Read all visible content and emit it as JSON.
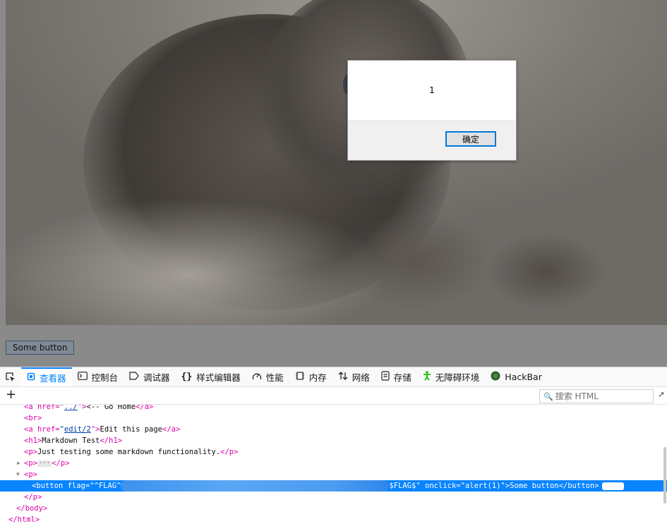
{
  "page": {
    "button_label": "Some button"
  },
  "dialog": {
    "message": "1",
    "ok_label": "确定"
  },
  "devtools": {
    "tabs": [
      {
        "label": "查看器",
        "icon": "inspector-icon",
        "active": true
      },
      {
        "label": "控制台",
        "icon": "console-icon"
      },
      {
        "label": "调试器",
        "icon": "debugger-icon"
      },
      {
        "label": "样式编辑器",
        "icon": "style-editor-icon"
      },
      {
        "label": "性能",
        "icon": "performance-icon"
      },
      {
        "label": "内存",
        "icon": "memory-icon"
      },
      {
        "label": "网络",
        "icon": "network-icon"
      },
      {
        "label": "存储",
        "icon": "storage-icon"
      },
      {
        "label": "无障碍环境",
        "icon": "accessibility-icon"
      },
      {
        "label": "HackBar",
        "icon": "hackbar-icon"
      }
    ],
    "search_placeholder": "搜索 HTML",
    "accent": "#0a84ff",
    "markup": {
      "line1": {
        "tag_open": "<a ",
        "attr": "href=",
        "q1": "\"",
        "href": "../",
        "q2": "\">",
        "text": "<-- Go Home",
        "tag_close": "</a>"
      },
      "line2": "<br>",
      "line3": {
        "tag_open": "<a ",
        "attr": "href=",
        "q1": "\"",
        "href": "edit/2",
        "q2": "\">",
        "text": "Edit this page",
        "tag_close": "</a>"
      },
      "line4": {
        "open": "<h1>",
        "text": "Markdown Test",
        "close": "</h1>"
      },
      "line5": {
        "open": "<p>",
        "text": "Just testing some markdown functionality.",
        "close": "</p>"
      },
      "line6": {
        "open": "<p>",
        "ellipsis": "···",
        "close": "</p>"
      },
      "line7": "<p>",
      "line8": {
        "start": "<button ",
        "attr1": "flag=",
        "val1_start": "\"^FLAG^",
        "val1_end": "$FLAG$\"",
        "attr2": " onclick=",
        "val2": "\"alert(1)\"",
        "gt": ">",
        "text": "Some button",
        "close": "</button>",
        "badge": "event"
      },
      "line9": "</p>",
      "line10": "</body>",
      "line11": "</html>"
    }
  }
}
